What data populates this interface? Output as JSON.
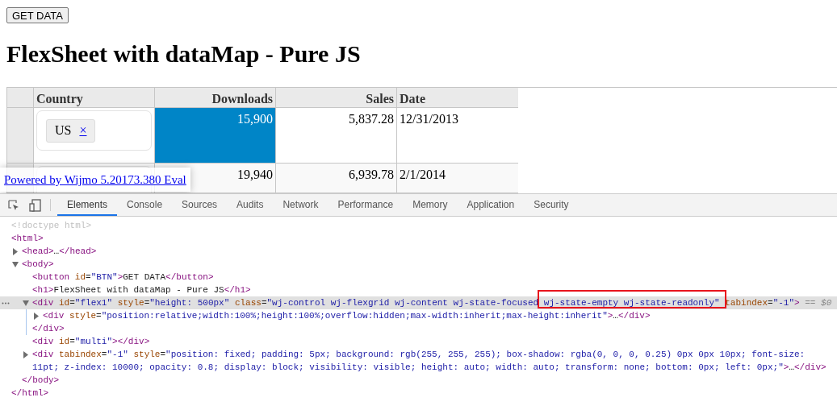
{
  "page": {
    "button": "GET DATA",
    "heading": "FlexSheet with dataMap - Pure JS"
  },
  "grid": {
    "columns": [
      {
        "label": "Country",
        "kind": "text"
      },
      {
        "label": "Downloads",
        "kind": "number"
      },
      {
        "label": "Sales",
        "kind": "number"
      },
      {
        "label": "Date",
        "kind": "text"
      }
    ],
    "rows": [
      {
        "cells": [
          {
            "kind": "tags",
            "tags": [
              {
                "label": "US",
                "remove": "×"
              }
            ],
            "selected": false
          },
          {
            "kind": "value",
            "text": "15,900",
            "selected": true
          },
          {
            "kind": "value",
            "text": "5,837.28",
            "selected": false
          },
          {
            "kind": "value",
            "text": "12/31/2013",
            "selected": false
          }
        ]
      },
      {
        "cells": [
          {
            "kind": "tags",
            "selected": false
          },
          {
            "kind": "value",
            "text": "19,940",
            "selected": false
          },
          {
            "kind": "value",
            "text": "6,939.78",
            "selected": false
          },
          {
            "kind": "value",
            "text": "2/1/2014",
            "selected": false
          }
        ]
      }
    ]
  },
  "watermark_link": "Powered by Wijmo 5.20173.380 Eval",
  "devtools": {
    "tabs": [
      {
        "label": "Elements",
        "selected": true
      },
      {
        "label": "Console",
        "selected": false
      },
      {
        "label": "Sources",
        "selected": false
      },
      {
        "label": "Audits",
        "selected": false
      },
      {
        "label": "Network",
        "selected": false
      },
      {
        "label": "Performance",
        "selected": false
      },
      {
        "label": "Memory",
        "selected": false
      },
      {
        "label": "Application",
        "selected": false
      },
      {
        "label": "Security",
        "selected": false
      }
    ],
    "dom": [
      {
        "open": [
          {
            "kind": "doctype",
            "text": "<!doctype html>"
          }
        ],
        "selected": false
      },
      {
        "open": [
          {
            "kind": "tag",
            "text": "<html>"
          }
        ],
        "selected": false,
        "children": [
          {
            "open": [
              {
                "kind": "tag",
                "text": "<head>"
              },
              {
                "kind": "text",
                "text": "…"
              },
              {
                "kind": "tag",
                "text": "</head>"
              }
            ],
            "expanded": false,
            "selected": false
          },
          {
            "open": [
              {
                "kind": "tag",
                "text": "<body>"
              }
            ],
            "expanded": true,
            "selected": false,
            "children": [
              {
                "open": [
                  {
                    "kind": "tag",
                    "text": "<button"
                  },
                  {
                    "kind": "attr",
                    "text": " id"
                  },
                  {
                    "kind": "text",
                    "text": "="
                  },
                  {
                    "kind": "value",
                    "text": "\"BTN\""
                  },
                  {
                    "kind": "tag",
                    "text": ">"
                  },
                  {
                    "kind": "text",
                    "text": "GET DATA"
                  },
                  {
                    "kind": "tag",
                    "text": "</button>"
                  }
                ],
                "selected": false
              },
              {
                "open": [
                  {
                    "kind": "tag",
                    "text": "<h1>"
                  },
                  {
                    "kind": "text",
                    "text": "FlexSheet with dataMap - Pure JS"
                  },
                  {
                    "kind": "tag",
                    "text": "</h1>"
                  }
                ],
                "selected": false
              },
              {
                "open": [
                  {
                    "kind": "tag",
                    "text": "<div"
                  },
                  {
                    "kind": "attr",
                    "text": " id"
                  },
                  {
                    "kind": "text",
                    "text": "="
                  },
                  {
                    "kind": "value",
                    "text": "\"flex1\""
                  },
                  {
                    "kind": "attr",
                    "text": " style"
                  },
                  {
                    "kind": "text",
                    "text": "="
                  },
                  {
                    "kind": "value",
                    "text": "\"height: 500px\""
                  },
                  {
                    "kind": "attr",
                    "text": " class"
                  },
                  {
                    "kind": "text",
                    "text": "="
                  },
                  {
                    "kind": "value",
                    "text": "\"wj-control wj-flexgrid wj-content wj-state-focused "
                  },
                  {
                    "kind": "value",
                    "text": "wj-state-empty wj-state-readonly\"",
                    "highlight": true
                  },
                  {
                    "kind": "attr",
                    "text": " tabindex"
                  },
                  {
                    "kind": "text",
                    "text": "="
                  },
                  {
                    "kind": "value",
                    "text": "\"-1\""
                  },
                  {
                    "kind": "tag",
                    "text": ">"
                  },
                  {
                    "kind": "hint",
                    "text": " == $0"
                  }
                ],
                "expanded": true,
                "selected": true,
                "children": [
                  {
                    "open": [
                      {
                        "kind": "tag",
                        "text": "<div"
                      },
                      {
                        "kind": "attr",
                        "text": " style"
                      },
                      {
                        "kind": "text",
                        "text": "="
                      },
                      {
                        "kind": "value",
                        "text": "\"position:relative;width:100%;height:100%;overflow:hidden;max-width:inherit;max-height:inherit\""
                      },
                      {
                        "kind": "tag",
                        "text": ">"
                      },
                      {
                        "kind": "text",
                        "text": "…"
                      },
                      {
                        "kind": "tag",
                        "text": "</div>"
                      }
                    ],
                    "expanded": false,
                    "selected": false
                  }
                ],
                "close": [
                  {
                    "kind": "tag",
                    "text": "</div>"
                  }
                ]
              },
              {
                "open": [
                  {
                    "kind": "tag",
                    "text": "<div"
                  },
                  {
                    "kind": "attr",
                    "text": " id"
                  },
                  {
                    "kind": "text",
                    "text": "="
                  },
                  {
                    "kind": "value",
                    "text": "\"multi\""
                  },
                  {
                    "kind": "tag",
                    "text": "></div>"
                  }
                ],
                "selected": false
              },
              {
                "open": [
                  {
                    "kind": "tag",
                    "text": "<div"
                  },
                  {
                    "kind": "attr",
                    "text": " tabindex"
                  },
                  {
                    "kind": "text",
                    "text": "="
                  },
                  {
                    "kind": "value",
                    "text": "\"-1\""
                  },
                  {
                    "kind": "attr",
                    "text": " style"
                  },
                  {
                    "kind": "text",
                    "text": "="
                  },
                  {
                    "kind": "value",
                    "text": "\"position: fixed; padding: 5px; background: rgb(255, 255, 255); box-shadow: rgba(0, 0, 0, 0.25) 0px 0px 10px; font-size: 11pt; z-index: 10000; opacity: 0.8; display: block; visibility: visible; height: auto; width: auto; transform: none; bottom: 0px; left: 0px;\""
                  },
                  {
                    "kind": "tag",
                    "text": ">"
                  },
                  {
                    "kind": "text",
                    "text": "…"
                  },
                  {
                    "kind": "tag",
                    "text": "</div>"
                  }
                ],
                "expanded": false,
                "selected": false
              }
            ],
            "close": [
              {
                "kind": "tag",
                "text": "</body>"
              }
            ]
          }
        ],
        "close": [
          {
            "kind": "tag",
            "text": "</html>"
          }
        ]
      }
    ]
  }
}
